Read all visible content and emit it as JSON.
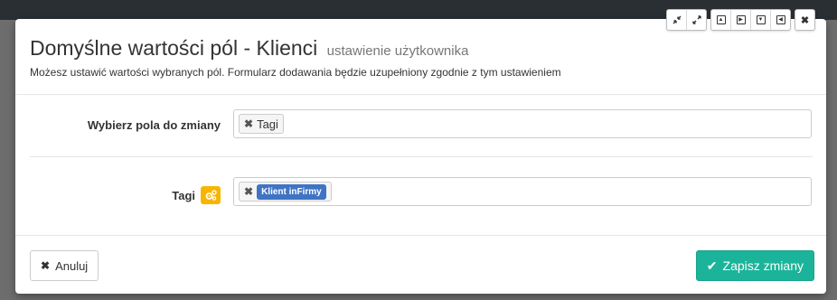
{
  "modal": {
    "title": "Domyślne wartości pól - Klienci",
    "subtitle": "ustawienie użytkownika",
    "description": "Możesz ustawić wartości wybranych pól. Formularz dodawania będzie uzupełniony zgodnie z tym ustawieniem"
  },
  "window_controls": [
    "minimize-icon",
    "maximize-icon",
    "move-up-icon",
    "move-right-icon",
    "move-down-icon",
    "move-left-icon",
    "close-icon"
  ],
  "fields": {
    "select_fields": {
      "label": "Wybierz pola do zmiany",
      "chip": "Tagi",
      "remove": "✖"
    },
    "tags": {
      "label": "Tagi",
      "chip": "Klient inFirmy",
      "remove": "✖",
      "icon": "cogs-icon"
    }
  },
  "footer": {
    "cancel_label": "Anuluj",
    "cancel_icon": "✖",
    "save_label": "Zapisz zmiany",
    "save_icon": "✔"
  },
  "colors": {
    "save_button": "#1bb49a",
    "tag_badge": "#3f74c5",
    "icon_badge": "#f7b500"
  }
}
